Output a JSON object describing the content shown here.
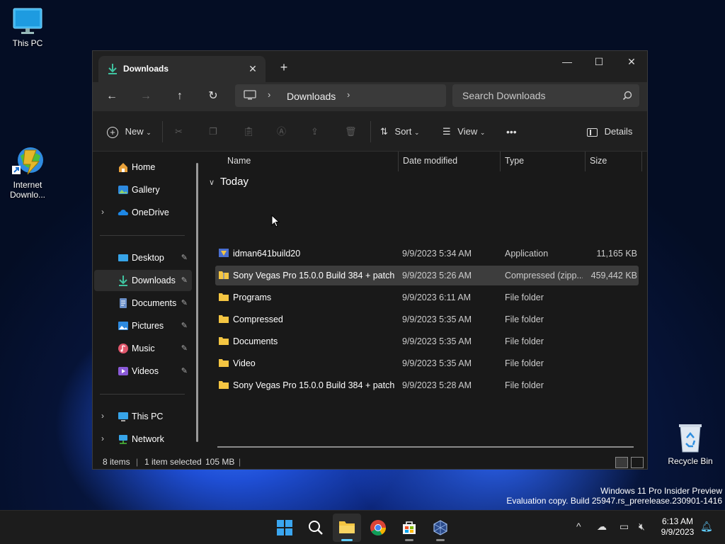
{
  "desktop": {
    "icons": [
      {
        "label": "This PC"
      },
      {
        "label": "Internet Downlo..."
      },
      {
        "label": "Recycle Bin"
      }
    ],
    "watermark": {
      "line1": "Windows 11 Pro Insider Preview",
      "line2": "Evaluation copy. Build 25947.rs_prerelease.230901-1416"
    }
  },
  "window": {
    "tab_title": "Downloads",
    "tab_close": "✕",
    "new_tab": "+",
    "controls": {
      "minimize": "—",
      "maximize": "☐",
      "close": "✕"
    }
  },
  "nav": {
    "back": "←",
    "forward": "→",
    "up": "↑",
    "refresh": "↻",
    "breadcrumb": [
      "Downloads"
    ],
    "search_placeholder": "Search Downloads"
  },
  "toolbar": {
    "new_label": "New",
    "sort_label": "Sort",
    "view_label": "View",
    "more_label": "•••",
    "details_label": "Details"
  },
  "sidebar": {
    "items": [
      {
        "label": "Home",
        "icon": "home-icon"
      },
      {
        "label": "Gallery",
        "icon": "gallery-icon"
      },
      {
        "label": "OneDrive",
        "icon": "onedrive-icon",
        "expander": "›"
      },
      {
        "label": "Desktop",
        "icon": "desktop-icon",
        "pinned": true
      },
      {
        "label": "Downloads",
        "icon": "downloads-icon",
        "pinned": true,
        "selected": true
      },
      {
        "label": "Documents",
        "icon": "documents-icon",
        "pinned": true
      },
      {
        "label": "Pictures",
        "icon": "pictures-icon",
        "pinned": true
      },
      {
        "label": "Music",
        "icon": "music-icon",
        "pinned": true
      },
      {
        "label": "Videos",
        "icon": "videos-icon",
        "pinned": true
      },
      {
        "label": "This PC",
        "icon": "this-pc-icon",
        "expander": "›"
      },
      {
        "label": "Network",
        "icon": "network-icon",
        "expander": "›"
      }
    ],
    "pin_glyph": "📌"
  },
  "file_list": {
    "columns": {
      "name": "Name",
      "date": "Date modified",
      "type": "Type",
      "size": "Size"
    },
    "group_label": "Today",
    "group_chevron": "∨",
    "rows": [
      {
        "name": "idman641build20",
        "date": "9/9/2023 5:34 AM",
        "type": "Application",
        "size": "11,165 KB",
        "icon": "app-icon"
      },
      {
        "name": "Sony Vegas Pro 15.0.0 Build 384 + patch -...",
        "date": "9/9/2023 5:26 AM",
        "type": "Compressed (zipp...",
        "size": "459,442 KB",
        "icon": "zip-folder-icon",
        "selected": true
      },
      {
        "name": "Programs",
        "date": "9/9/2023 6:11 AM",
        "type": "File folder",
        "size": "",
        "icon": "folder-icon"
      },
      {
        "name": "Compressed",
        "date": "9/9/2023 5:35 AM",
        "type": "File folder",
        "size": "",
        "icon": "folder-icon"
      },
      {
        "name": "Documents",
        "date": "9/9/2023 5:35 AM",
        "type": "File folder",
        "size": "",
        "icon": "folder-icon"
      },
      {
        "name": "Video",
        "date": "9/9/2023 5:35 AM",
        "type": "File folder",
        "size": "",
        "icon": "folder-icon"
      },
      {
        "name": "Sony Vegas Pro 15.0.0 Build 384 + patch -...",
        "date": "9/9/2023 5:28 AM",
        "type": "File folder",
        "size": "",
        "icon": "folder-icon"
      }
    ]
  },
  "status": {
    "item_count": "8 items",
    "selection": "1 item selected",
    "selection_size": "105 MB"
  },
  "taskbar": {
    "apps": [
      "start-icon",
      "search-icon",
      "file-explorer-icon",
      "chrome-icon",
      "microsoft-store-icon",
      "virtualbox-icon"
    ],
    "tray_chevron": "^",
    "time": "6:13 AM",
    "date": "9/9/2023"
  },
  "colors": {
    "accent": "#60cdff",
    "folder": "#f4c542",
    "window_bg": "#191919",
    "selection_bg": "#3d3d3d"
  }
}
